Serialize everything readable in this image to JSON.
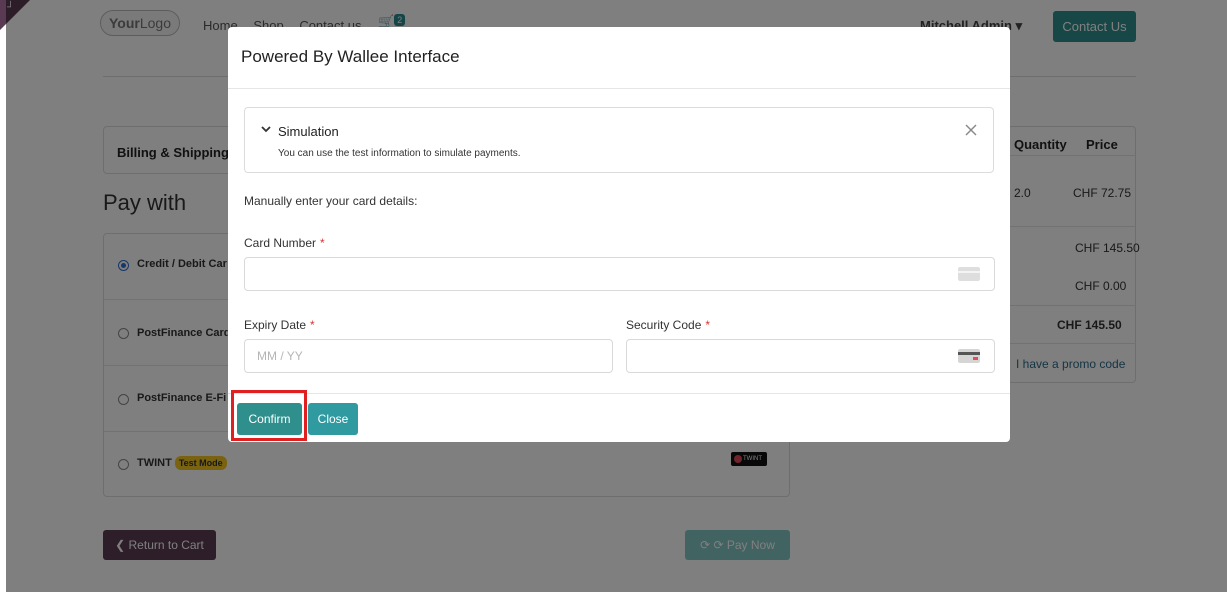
{
  "nav": {
    "logo_bold": "Your",
    "logo_lite": "Logo",
    "links": [
      "Home",
      "Shop",
      "Contact us"
    ],
    "cart_count": "2",
    "user": "Mitchell Admin",
    "contact_label": "Contact Us"
  },
  "checkout": {
    "billing_title": "Billing & Shipping:",
    "pay_with": "Pay with",
    "methods": [
      {
        "label": "Credit / Debit Car",
        "selected": true
      },
      {
        "label": "PostFinance Card",
        "selected": false
      },
      {
        "label": "PostFinance E-Fi",
        "selected": false
      },
      {
        "label": "TWINT",
        "badge": "Test Mode",
        "logo": "TWINT",
        "selected": false
      }
    ],
    "return_label": "Return to Cart",
    "paynow_label": "Pay Now"
  },
  "summary": {
    "quantity_header": "Quantity",
    "price_header": "Price",
    "line_qty": "2.0",
    "line_price": "CHF 72.75",
    "subtotal": "CHF 145.50",
    "taxes": "CHF 0.00",
    "total": "CHF 145.50",
    "promo": "I have a promo code"
  },
  "modal": {
    "title": "Powered By Wallee Interface",
    "simulation_title": "Simulation",
    "simulation_desc": "You can use the test information to simulate payments.",
    "manual_text": "Manually enter your card details:",
    "card_number_label": "Card Number",
    "expiry_label": "Expiry Date",
    "expiry_placeholder": "MM / YY",
    "security_label": "Security Code",
    "required_mark": "*",
    "confirm_label": "Confirm",
    "close_label": "Close"
  },
  "colors": {
    "primary": "#2f8f8c",
    "secondary": "#5b3c53",
    "highlight": "#e02020",
    "badge": "#f3c623"
  }
}
